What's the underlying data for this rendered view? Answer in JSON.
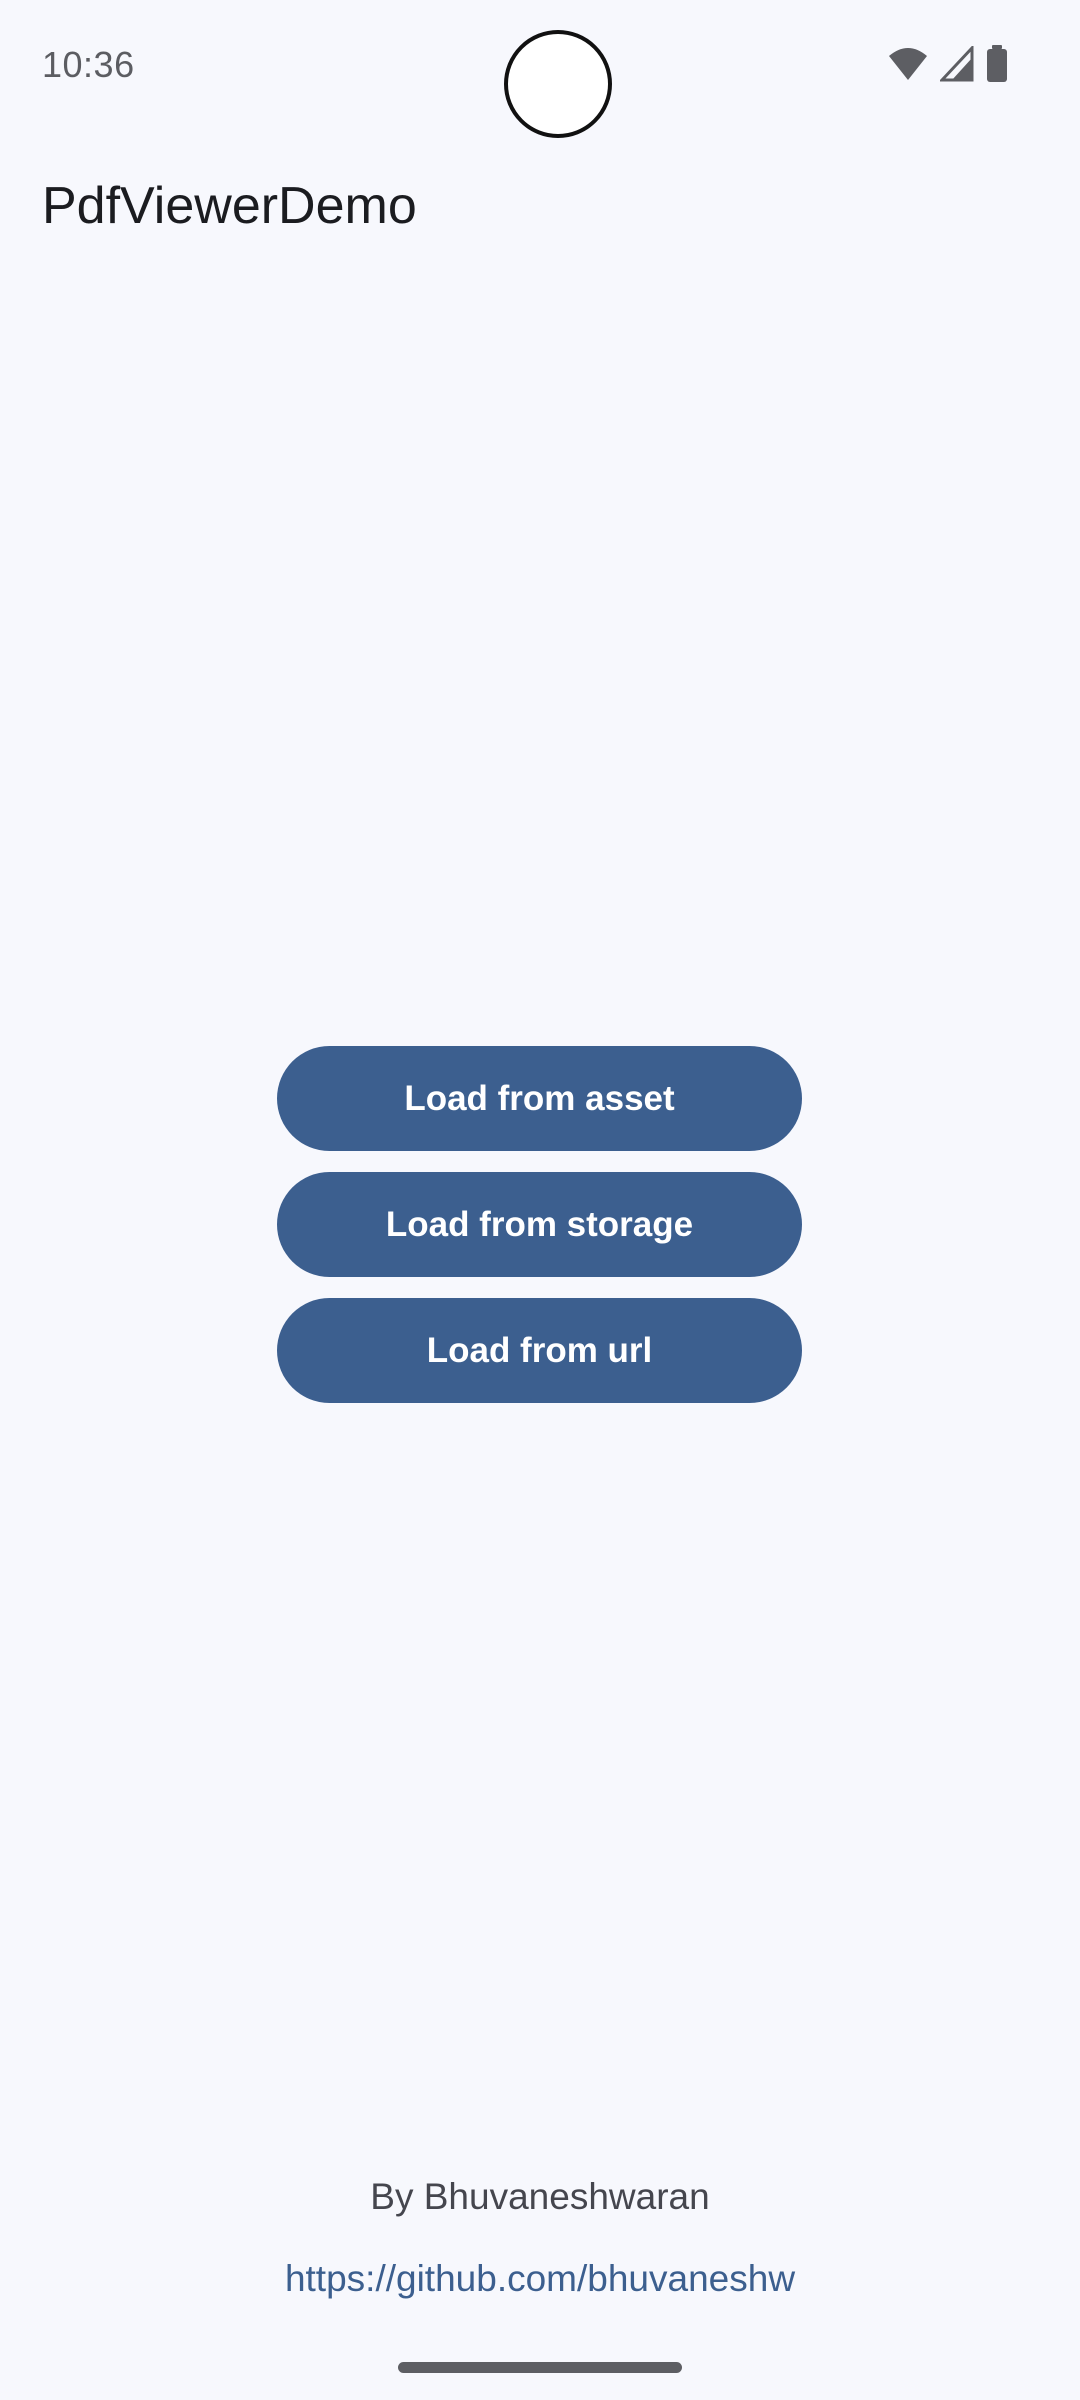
{
  "status_bar": {
    "time": "10:36",
    "icons": [
      "wifi-icon",
      "cellular-signal-icon",
      "battery-icon"
    ]
  },
  "app_bar": {
    "title": "PdfViewerDemo"
  },
  "actions": {
    "load_asset_label": "Load from asset",
    "load_storage_label": "Load from storage",
    "load_url_label": "Load from url"
  },
  "footer": {
    "author": "By Bhuvaneshwaran",
    "link": "https://github.com/bhuvaneshw"
  },
  "colors": {
    "background": "#f7f8fd",
    "primary": "#3c5f8f",
    "on_primary": "#ffffff",
    "title_text": "#1b1c20"
  }
}
